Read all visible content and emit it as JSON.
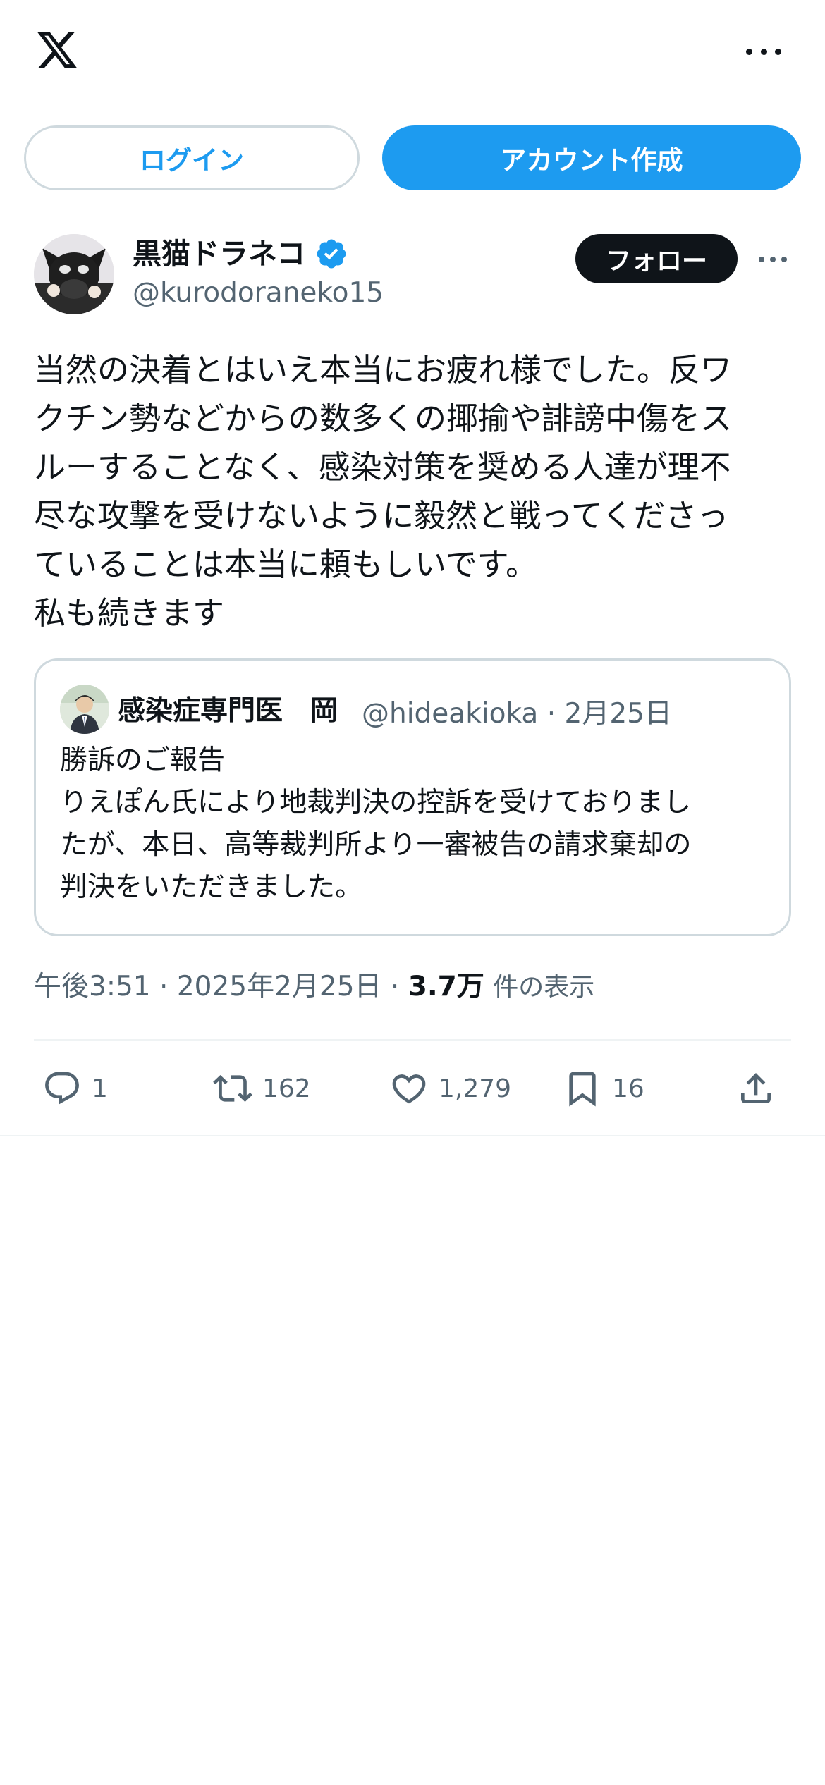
{
  "app": {
    "logo": "x-logo",
    "menu_icon": "more-horizontal-icon"
  },
  "auth": {
    "login_label": "ログイン",
    "signup_label": "アカウント作成"
  },
  "tweet": {
    "author": {
      "display_name": "黒猫ドラネコ",
      "handle": "@kurodoraneko15",
      "verified": true,
      "verified_icon": "verified-badge-icon"
    },
    "follow_label": "フォロー",
    "body_lines": [
      "当然の決着とはいえ本当にお疲れ様でした。反ワ",
      "クチン勢などからの数多くの揶揄や誹謗中傷をス",
      "ルーすることなく、感染対策を奨める人達が理不",
      "尽な攻撃を受けないように毅然と戦ってくださっ",
      "ていることは本当に頼もしいです。",
      "私も続きます"
    ],
    "quote": {
      "author_name": "感染症専門医　岡",
      "handle": "@hideakioka",
      "separator": "·",
      "date": "2月25日",
      "text_lines": [
        "勝訴のご報告",
        "りえぽん氏により地裁判決の控訴を受けておりまし",
        "たが、本日、高等裁判所より一審被告の請求棄却の",
        "判決をいただきました。"
      ]
    },
    "timestamp": {
      "time": "午後3:51",
      "separator": "·",
      "date": "2025年2月25日",
      "views_count": "3.7万",
      "views_label": "件の表示"
    },
    "actions": {
      "replies": "1",
      "retweets": "162",
      "likes": "1,279",
      "bookmarks": "16"
    }
  },
  "colors": {
    "accent": "#1d9bf0",
    "text": "#0f1419",
    "secondary": "#536471",
    "border": "#cfd9de"
  }
}
